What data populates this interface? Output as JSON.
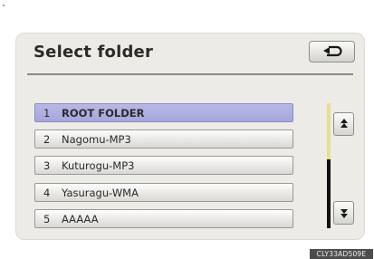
{
  "header": {
    "title": "Select folder",
    "back_icon": "return-arrow-icon"
  },
  "folders": [
    {
      "num": "1",
      "name": "ROOT FOLDER",
      "selected": true
    },
    {
      "num": "2",
      "name": "Nagomu-MP3",
      "selected": false
    },
    {
      "num": "3",
      "name": "Kuturogu-MP3",
      "selected": false
    },
    {
      "num": "4",
      "name": "Yasuragu-WMA",
      "selected": false
    },
    {
      "num": "5",
      "name": "AAAAA",
      "selected": false
    }
  ],
  "scroll": {
    "up_icon": "scroll-up-icon",
    "down_icon": "scroll-down-icon",
    "position_fraction": 0
  },
  "caption": "CLY33AD509E",
  "colors": {
    "selected_row": "#aaaadd",
    "scroll_thumb": "#e6e08e",
    "panel": "#ecebe6"
  }
}
